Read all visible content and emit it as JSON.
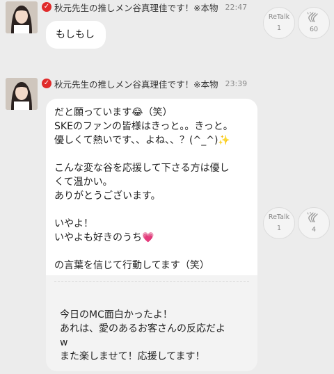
{
  "posts": [
    {
      "name": "秋元先生の推しメン谷真理佳です！※本物",
      "time": "22:47",
      "message": "もしもし",
      "retalk_label": "ReTalk",
      "retalk_count": "1",
      "like_count": "60"
    },
    {
      "name": "秋元先生の推しメン谷真理佳です！※本物",
      "time": "23:39",
      "message": "だと願っています😂（笑）\nSKEのファンの皆様はきっと。。きっと。\n優しくて熱いです、、よね、、？(^_^)✨\n\nこんな変な谷を応援して下さる方は優し\nくて温かい。\nありがとうございます。\n\nいやよ！\nいやよも好きのうち💗\n\nの言葉を信じて行動してます（笑）",
      "quote": "今日のMC面白かったよ！\nあれは、愛のあるお客さんの反応だよ\nw\nまた楽しませて！応援してます！",
      "retalk_label": "ReTalk",
      "retalk_count": "1",
      "like_count": "4"
    }
  ],
  "icons": {
    "verified": "verified-check-icon",
    "clap": "clap-hands-icon"
  },
  "colors": {
    "badge": "#e02a2a",
    "background": "#ececec"
  }
}
